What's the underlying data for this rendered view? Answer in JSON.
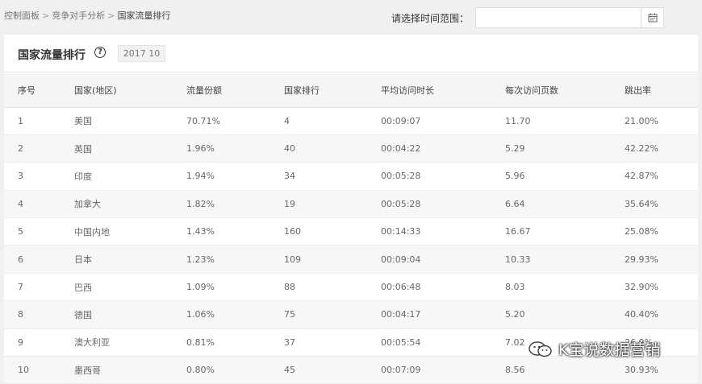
{
  "breadcrumb": {
    "items": [
      "控制面板",
      "竞争对手分析"
    ],
    "current": "国家流量排行",
    "separator": ">"
  },
  "date_range": {
    "label": "请选择时间范围：",
    "value": "",
    "placeholder": "",
    "icon": "calendar-icon"
  },
  "panel": {
    "title": "国家流量排行",
    "help_icon": "?",
    "period": "2017 10"
  },
  "table": {
    "columns": [
      "序号",
      "国家(地区)",
      "流量份额",
      "国家排行",
      "平均访问时长",
      "每次访问页数",
      "跳出率"
    ],
    "rows": [
      [
        "1",
        "美国",
        "70.71%",
        "4",
        "00:09:07",
        "11.70",
        "21.00%"
      ],
      [
        "2",
        "英国",
        "1.96%",
        "40",
        "00:04:22",
        "5.29",
        "42.22%"
      ],
      [
        "3",
        "印度",
        "1.94%",
        "34",
        "00:05:28",
        "5.96",
        "42.87%"
      ],
      [
        "4",
        "加拿大",
        "1.82%",
        "19",
        "00:05:28",
        "6.64",
        "35.64%"
      ],
      [
        "5",
        "中国内地",
        "1.43%",
        "160",
        "00:14:33",
        "16.67",
        "25.08%"
      ],
      [
        "6",
        "日本",
        "1.23%",
        "109",
        "00:09:04",
        "10.33",
        "29.93%"
      ],
      [
        "7",
        "巴西",
        "1.09%",
        "88",
        "00:06:48",
        "8.03",
        "32.90%"
      ],
      [
        "8",
        "德国",
        "1.06%",
        "75",
        "00:04:17",
        "5.20",
        "40.40%"
      ],
      [
        "9",
        "澳大利亚",
        "0.81%",
        "37",
        "00:05:54",
        "7.02",
        "26.9%"
      ],
      [
        "10",
        "墨西哥",
        "0.80%",
        "45",
        "00:07:09",
        "8.56",
        "30.93%"
      ]
    ]
  },
  "watermark": {
    "text": "K宝说数据营销"
  },
  "colors": {
    "background": "#f0f0f0",
    "panel": "#ffffff",
    "header_row": "#f5f5f5",
    "stripe": "#f7f7f7"
  }
}
